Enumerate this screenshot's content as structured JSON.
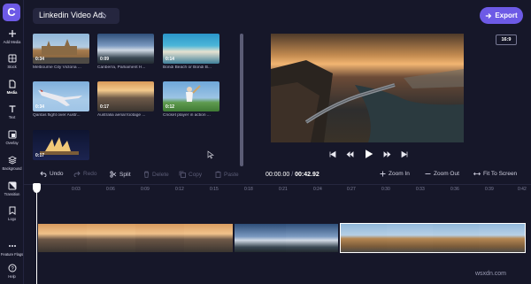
{
  "app": {
    "title": "Linkedin Video Ad",
    "export_label": "Export",
    "aspect_ratio": "16:9",
    "accent": "#6d5ae6"
  },
  "sidebar": {
    "logo": "C",
    "items": [
      {
        "label": "Add Media",
        "icon": "plus-icon"
      },
      {
        "label": "Stock",
        "icon": "grid-icon"
      },
      {
        "label": "Media",
        "icon": "file-icon"
      },
      {
        "label": "Text",
        "icon": "text-icon"
      },
      {
        "label": "Overlay",
        "icon": "overlay-icon"
      },
      {
        "label": "Background",
        "icon": "layers-icon"
      },
      {
        "label": "Transition",
        "icon": "transition-icon"
      },
      {
        "label": "Logo",
        "icon": "logo-icon"
      },
      {
        "label": "Feature Flags",
        "icon": "dots-icon"
      },
      {
        "label": "Help",
        "icon": "help-icon"
      }
    ]
  },
  "media": [
    {
      "duration": "0:34",
      "caption": "Melbourne City Victoria ...",
      "scene": "building"
    },
    {
      "duration": "0:09",
      "caption": "Canberra, Parliament H...",
      "scene": "sky"
    },
    {
      "duration": "0:14",
      "caption": "Bondi Beach or Bondi B...",
      "scene": "beach"
    },
    {
      "duration": "0:34",
      "caption": "Qantas flight over Austr...",
      "scene": "plane"
    },
    {
      "duration": "0:17",
      "caption": "Australia aerial footage ...",
      "scene": "aerial"
    },
    {
      "duration": "0:12",
      "caption": "Cricket player in action ...",
      "scene": "cricket"
    },
    {
      "duration": "0:17",
      "caption": "",
      "scene": "opera"
    }
  ],
  "toolbar": {
    "undo": "Undo",
    "redo": "Redo",
    "split": "Split",
    "delete": "Delete",
    "copy": "Copy",
    "paste": "Paste",
    "zoom_in": "Zoom In",
    "zoom_out": "Zoom Out",
    "fit": "Fit To Screen"
  },
  "timecode": {
    "current": "00:00.00",
    "separator": "/",
    "total": "00:42.92"
  },
  "ruler": [
    "0:03",
    "0:06",
    "0:09",
    "0:12",
    "0:15",
    "0:18",
    "0:21",
    "0:24",
    "0:27",
    "0:30",
    "0:33",
    "0:36",
    "0:39",
    "0:42"
  ],
  "watermark": "wsxdn.com"
}
